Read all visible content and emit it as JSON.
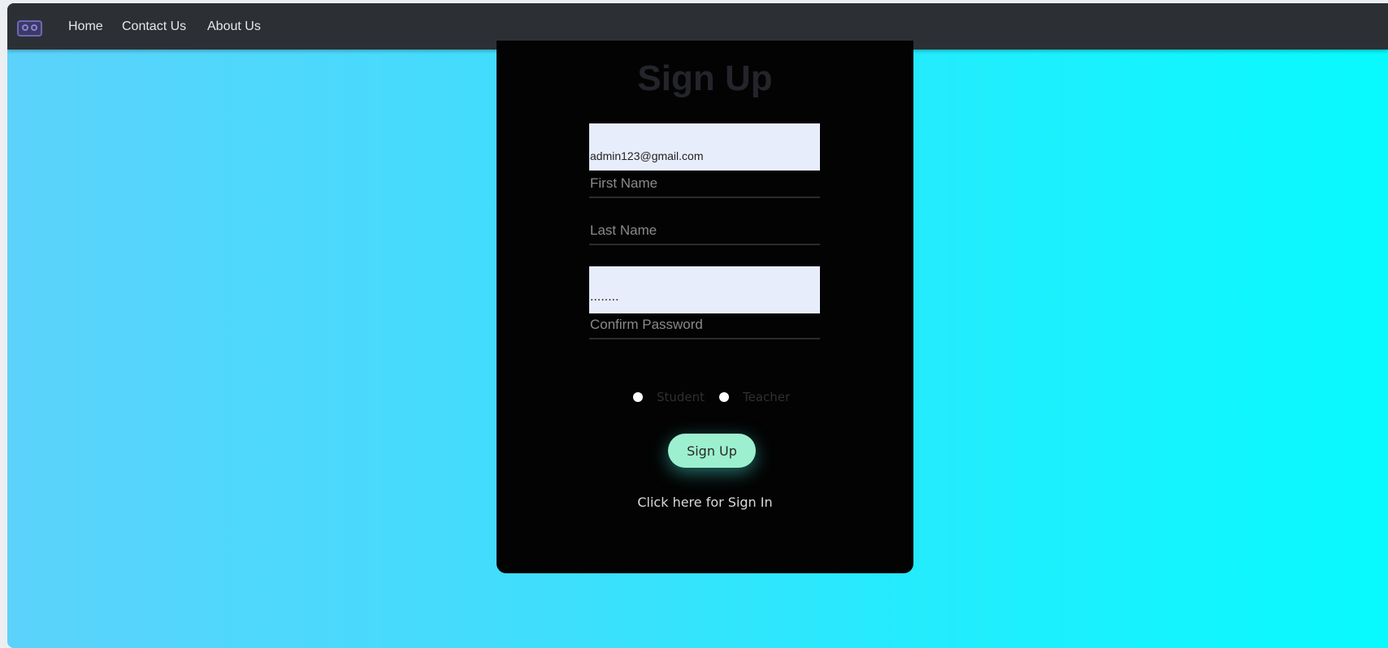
{
  "nav": {
    "logo_icon": "logo-icon",
    "links": [
      "Home",
      "Contact Us",
      "About Us"
    ]
  },
  "form": {
    "title": "Sign Up",
    "email_value": "admin123@gmail.com",
    "first_name_placeholder": "First Name",
    "last_name_placeholder": "Last Name",
    "password_value": "........",
    "confirm_password_placeholder": "Confirm Password",
    "role_options": [
      "Student",
      "Teacher"
    ],
    "submit_label": "Sign Up",
    "signin_link": "Click here for Sign In"
  },
  "colors": {
    "navbar": "#2c3035",
    "card": "#030303",
    "button": "#9df0cf",
    "gradient_start": "#5cd2fb",
    "gradient_end": "#07fafe"
  }
}
